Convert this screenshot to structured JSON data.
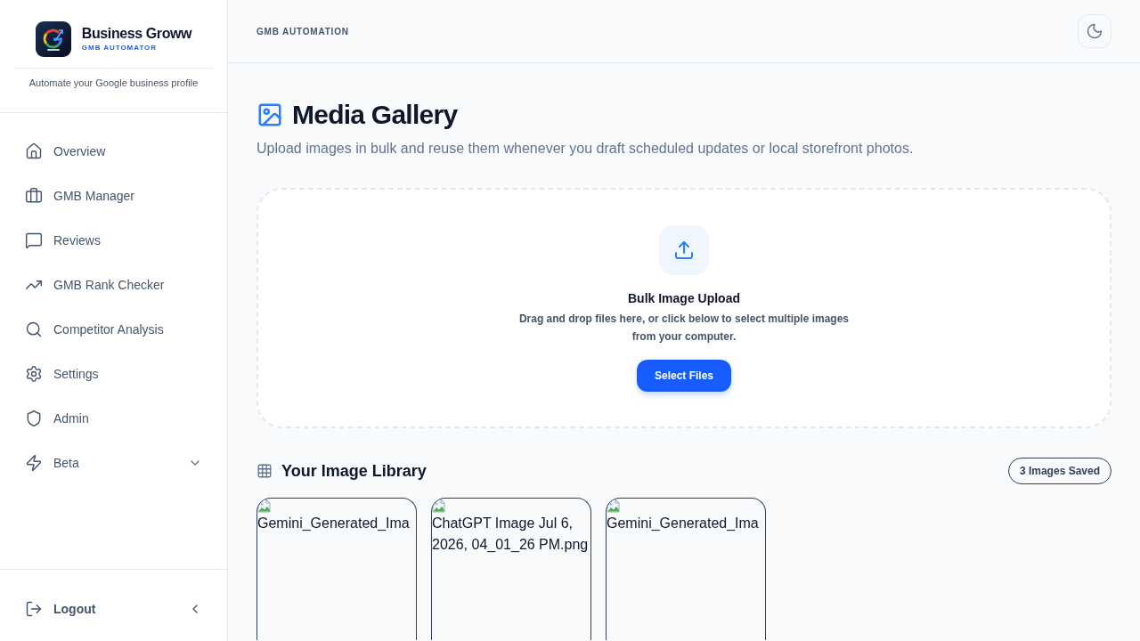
{
  "sidebar": {
    "brand": {
      "name": "Business Groww",
      "subtitle": "GMB AUTOMATOR",
      "tagline": "Automate your Google business profile"
    },
    "nav_items": [
      {
        "label": "Overview",
        "kind": "link"
      },
      {
        "label": "GMB Manager",
        "kind": "link"
      },
      {
        "label": "Reviews",
        "kind": "link"
      },
      {
        "label": "GMB Rank Checker",
        "kind": "link"
      },
      {
        "label": "Competitor Analysis",
        "kind": "link"
      },
      {
        "label": "Settings",
        "kind": "link"
      },
      {
        "label": "Admin",
        "kind": "link"
      },
      {
        "label": "Beta",
        "kind": "group",
        "expanded": false
      }
    ],
    "footer": {
      "logout_label": "Logout"
    }
  },
  "header": {
    "title": "GMB AUTOMATION"
  },
  "page": {
    "title": "Media Gallery",
    "subtitle": "Upload images in bulk and reuse them whenever you draft scheduled updates or local storefront photos."
  },
  "upload": {
    "title": "Bulk Image Upload",
    "description": "Drag and drop files here, or click below to select multiple images from your computer.",
    "button": "Select Files"
  },
  "library": {
    "title": "Your Image Library",
    "count_badge": "3 Images Saved",
    "images": [
      {
        "alt": "Gemini_Generated_Ima"
      },
      {
        "alt": "ChatGPT Image Jul 6, 2026, 04_01_26 PM.png"
      },
      {
        "alt": "Gemini_Generated_Ima"
      }
    ]
  }
}
